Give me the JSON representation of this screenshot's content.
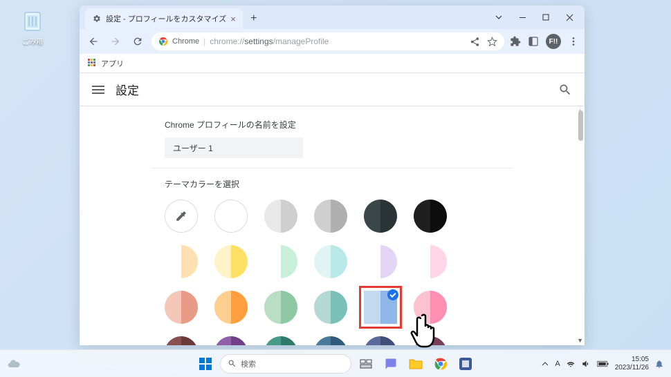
{
  "desktop": {
    "recycle_label": "ごみ箱"
  },
  "window": {
    "tab_title": "設定 - プロフィールをカスタマイズ",
    "address_secure": "Chrome",
    "address_path1": "chrome://",
    "address_path2": "settings",
    "address_path3": "/manageProfile",
    "profile_badge": "F!!"
  },
  "bookmarks": {
    "apps_label": "アプリ"
  },
  "settings": {
    "header_title": "設定",
    "section_name_title": "Chrome プロフィールの名前を設定",
    "profile_name_value": "ユーザー 1",
    "section_theme_title": "テーマカラーを選択"
  },
  "theme_colors": [
    {
      "type": "custom"
    },
    {
      "type": "default"
    },
    {
      "l": "#e8e8e8",
      "r": "#cfcfcf"
    },
    {
      "l": "#cfcfcf",
      "r": "#b0b0b0"
    },
    {
      "l": "#3a4648",
      "r": "#2a3436"
    },
    {
      "l": "#1f1f1f",
      "r": "#0d0d0d"
    },
    {
      "l": "#ffffff",
      "r": "#ffe0b2"
    },
    {
      "l": "#fff4c7",
      "r": "#ffe066"
    },
    {
      "l": "#ffffff",
      "r": "#c8f0d8"
    },
    {
      "l": "#e0f4f4",
      "r": "#b8e8e8"
    },
    {
      "l": "#ffffff",
      "r": "#e4d5f7"
    },
    {
      "l": "#ffffff",
      "r": "#ffd6e8"
    },
    {
      "l": "#f5c7b8",
      "r": "#e89b87"
    },
    {
      "l": "#ffcf8f",
      "r": "#ff9f40"
    },
    {
      "l": "#b8dec4",
      "r": "#8fc9a3"
    },
    {
      "l": "#b4d9d4",
      "r": "#7bc0b8"
    },
    {
      "l": "#c3d9f0",
      "r": "#8fb8e8",
      "selected": true
    },
    {
      "l": "#ffc2d1",
      "r": "#ff8fb0"
    },
    {
      "l": "#8a5050",
      "r": "#6b3a3a"
    },
    {
      "l": "#8f5fa8",
      "r": "#6f4088"
    },
    {
      "l": "#4a9a8a",
      "r": "#2f7a6a"
    },
    {
      "l": "#4a7a9a",
      "r": "#2f5a7a"
    },
    {
      "l": "#5a6a9a",
      "r": "#3f4f7a"
    },
    {
      "l": "#9a5a7a",
      "r": "#7a3f5a"
    }
  ],
  "taskbar": {
    "search_placeholder": "検索",
    "ime": "A",
    "time": "15:05",
    "date": "2023/11/26"
  }
}
